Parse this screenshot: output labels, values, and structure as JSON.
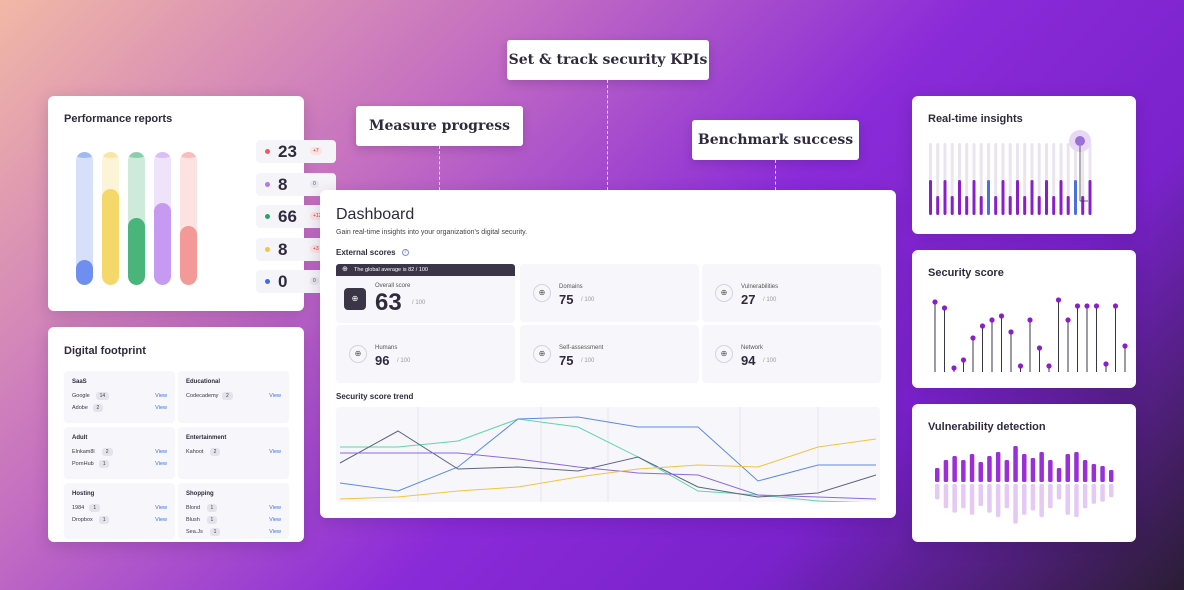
{
  "callouts": {
    "kpis": "Set & track security KPIs",
    "progress": "Measure progress",
    "benchmark": "Benchmark success"
  },
  "performance": {
    "title": "Performance reports",
    "bars": [
      {
        "color": "#6e8ff0",
        "level": 0.19
      },
      {
        "color": "#f5d86a",
        "level": 0.72
      },
      {
        "color": "#4ab57a",
        "level": 0.5
      },
      {
        "color": "#c79af2",
        "level": 0.62
      },
      {
        "color": "#f39a98",
        "level": 0.44
      }
    ],
    "stats": [
      {
        "value": "23",
        "badge": "+7",
        "up": true,
        "color": "#f05a5a"
      },
      {
        "value": "8",
        "badge": "0",
        "up": false,
        "color": "#b478e8"
      },
      {
        "value": "66",
        "badge": "+12",
        "up": true,
        "color": "#2ea060"
      },
      {
        "value": "8",
        "badge": "+3",
        "up": true,
        "color": "#f5c542"
      },
      {
        "value": "0",
        "badge": "0",
        "up": false,
        "color": "#3b6ee8"
      }
    ]
  },
  "footprint": {
    "title": "Digital footprint",
    "view_label": "View",
    "groups": [
      {
        "name": "SaaS",
        "items": [
          {
            "n": "Google",
            "c": "14"
          },
          {
            "n": "Adobe",
            "c": "2"
          }
        ]
      },
      {
        "name": "Educational",
        "items": [
          {
            "n": "Codecademy",
            "c": "2"
          }
        ]
      },
      {
        "name": "Adult",
        "items": [
          {
            "n": "Elnkam8l",
            "c": "2"
          },
          {
            "n": "PornHub",
            "c": "1"
          }
        ]
      },
      {
        "name": "Entertainment",
        "items": [
          {
            "n": "Kahoot",
            "c": "2"
          }
        ]
      },
      {
        "name": "Hosting",
        "items": [
          {
            "n": "1984",
            "c": "1"
          },
          {
            "n": "Dropbox",
            "c": "1"
          }
        ]
      },
      {
        "name": "Shopping",
        "items": [
          {
            "n": "Blond",
            "c": "1"
          },
          {
            "n": "Blush",
            "c": "1"
          },
          {
            "n": "Sea.Js",
            "c": "1"
          }
        ]
      }
    ]
  },
  "dashboard": {
    "title": "Dashboard",
    "subtitle": "Gain real-time insights into your organization's digital security.",
    "external_scores_label": "External scores",
    "tooltip": "The global average is 82 / 100",
    "denominator": "/ 100",
    "scores": [
      {
        "label": "Overall score",
        "value": "63"
      },
      {
        "label": "Domains",
        "value": "75"
      },
      {
        "label": "Vulnerabilities",
        "value": "27"
      },
      {
        "label": "Humans",
        "value": "96"
      },
      {
        "label": "Self-assessment",
        "value": "75"
      },
      {
        "label": "Network",
        "value": "94"
      }
    ],
    "trend_label": "Security score trend"
  },
  "realtime": {
    "title": "Real-time insights",
    "levels": [
      0.45,
      0.45,
      0.45,
      0.45,
      0.45,
      0.45,
      0.45,
      0.45,
      0.45,
      0.45,
      0.45,
      0.45,
      0.45,
      0.45,
      0.45,
      0.45,
      0.45,
      0.45,
      0.45,
      0.45,
      0.45
    ]
  },
  "security_score": {
    "title": "Security score"
  },
  "vuln": {
    "title": "Vulnerability detection"
  },
  "colors": {
    "purple": "#8a1fc9",
    "blue": "#3b6ee8"
  }
}
